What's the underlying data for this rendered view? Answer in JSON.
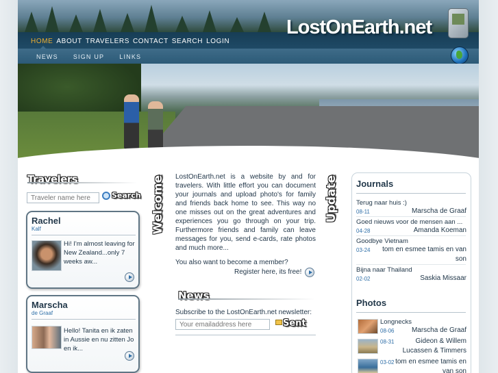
{
  "header": {
    "logo_text": "LostOnEarth.net",
    "menu": [
      "HOME",
      "ABOUT",
      "TRAVELERS",
      "CONTACT",
      "SEARCH",
      "LOGIN"
    ],
    "submenu": [
      "NEWS",
      "SIGN UP",
      "LINKS"
    ]
  },
  "travelers": {
    "heading": "Travelers",
    "input_placeholder": "Traveler name here",
    "search_label": "Search",
    "cards": [
      {
        "name": "Rachel",
        "sub": "Kalf",
        "text": "Hi! I'm almost leaving for New Zealand...only 7 weeks aw..."
      },
      {
        "name": "Marscha",
        "sub": "de Graaf",
        "text": "Hello! Tanita en ik zaten in Aussie en nu zitten Jo en ik..."
      }
    ]
  },
  "welcome": {
    "heading": "Welcome",
    "intro": "LostOnEarth.net is a website by and for travelers. With little effort you can document your journals and upload photo's for family and friends back home to see. This way no one misses out on the great adventures and experiences you go through on your trip. Furthermore friends and family can leave messages for you, send e-cards, rate photos and much more...",
    "member_question": "You also want to become a member?",
    "register_label": "Register here, its free!"
  },
  "news": {
    "heading": "News",
    "subscribe_text": "Subscribe to the LostOnEarth.net newsletter:",
    "email_placeholder": "Your emailaddress here",
    "send_label": "Sent"
  },
  "update": {
    "heading": "Update",
    "journals_heading": "Journals",
    "journals": [
      {
        "title": "Terug naar huis :)",
        "date": "08-11",
        "author": "Marscha de Graaf"
      },
      {
        "title": "Goed nieuws voor de mensen aan ...",
        "date": "04-28",
        "author": "Amanda Koeman"
      },
      {
        "title": "Goodbye Vietnam",
        "date": "03-24",
        "author": "tom en esmee tamis en van son"
      },
      {
        "title": "Bijna naar Thailand",
        "date": "02-02",
        "author": "Saskia Missaar"
      }
    ],
    "photos_heading": "Photos",
    "photos": [
      {
        "title": "Longnecks",
        "date": "08-06",
        "author": "Marscha de Graaf"
      },
      {
        "title": "",
        "date": "08-31",
        "author": "Gideon & Willem Lucassen & Timmers"
      },
      {
        "title": "",
        "date": "03-02",
        "author": "tom en esmee tamis en van son"
      }
    ]
  }
}
